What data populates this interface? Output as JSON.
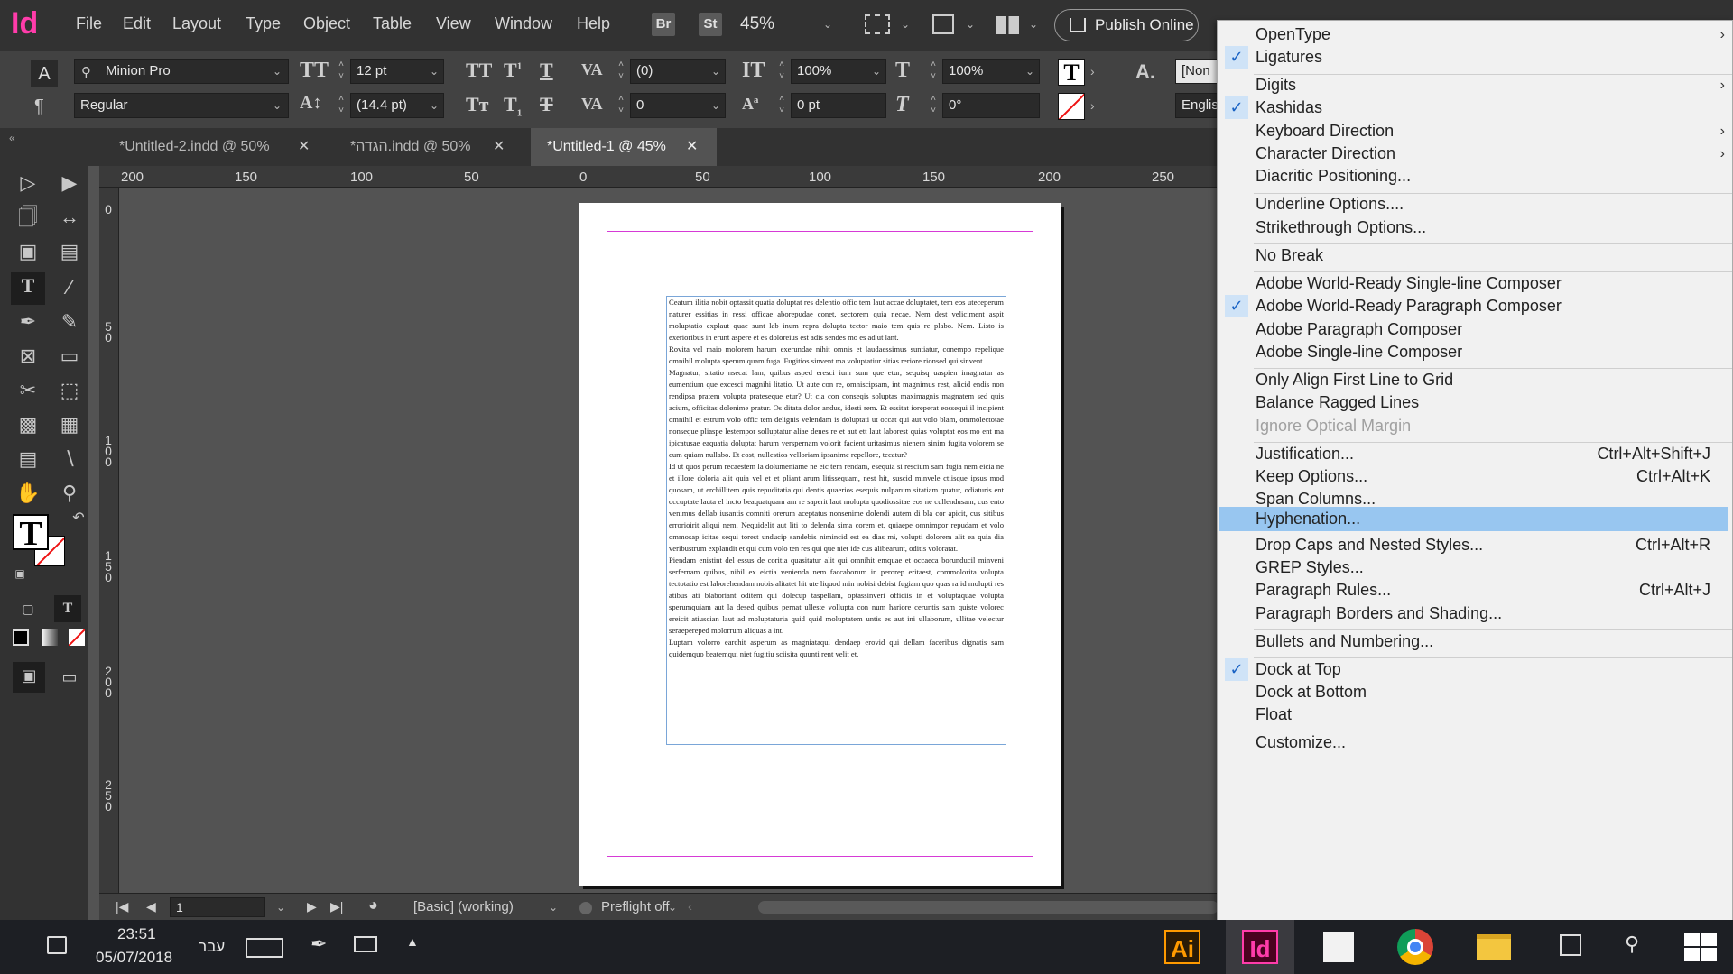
{
  "app": {
    "logo": "Id"
  },
  "menubar": {
    "items": [
      "File",
      "Edit",
      "Layout",
      "Type",
      "Object",
      "Table",
      "View",
      "Window",
      "Help"
    ],
    "bridge": "Br",
    "stock": "St",
    "zoom": "45%",
    "publish": "Publish Online"
  },
  "control": {
    "font_family": "Minion Pro",
    "font_style": "Regular",
    "font_size": "12 pt",
    "leading": "(14.4 pt)",
    "kerning": "(0)",
    "tracking": "0",
    "vscale": "100%",
    "hscale": "100%",
    "baseline": "0 pt",
    "skew": "0°",
    "style_box": "[Non",
    "language": "Englis"
  },
  "tabs": [
    {
      "label": "*Untitled-2.indd @ 50%"
    },
    {
      "label": "*הגדה.indd @ 50%"
    },
    {
      "label": "*Untitled-1 @ 45%"
    }
  ],
  "ruler": {
    "top": [
      "200",
      "150",
      "100",
      "50",
      "0",
      "50",
      "100",
      "150",
      "200",
      "250"
    ],
    "left": [
      "0",
      "50",
      "100",
      "150",
      "200",
      "250"
    ]
  },
  "document": {
    "paragraphs": [
      "Ceatum ilitia nobit optassit quatia doluptat res delentio offic tem laut accae doluptatet, tem eos uteceperum naturer essitias in ressi officae aborepudae conet, sectorem quia necae. Nem dest veliciment aspit moluptatio explaut quae sunt lab inum repra dolupta tector maio tem quis re plabo. Nem. Listo is exerioribus in erunt aspere et es doloreius est adis sendes mo es ad ut lant.",
      "Rovita vel maio molorem harum exerundae nihit omnis et laudaessimus suntiatur, conempo repelique omnihil molupta sperum quam fuga. Fugitios sinvent ma voluptatiur sitias reriore rionsed qui sinvent.",
      "Magnatur, sitatio nsecat lam, quibus asped eresci ium sum que etur, sequisq uaspien imagnatur as eumentium que excesci magnihi litatio. Ut aute con re, omniscipsam, int magnimus rest, alicid endis non rendipsa pratem volupta prateseque etur? Ut cia con conseqis soluptas maximagnis magnatem sed quis acium, officitas dolenime pratur. Os ditata dolor andus, idesti rem. Et essitat ioreperat eossequi il incipient omnihil et estrum volo offic tem delignis velendam is doluptati ut occat qui aut volo blam, ommolectotae nonseque pliaspe lestempor solluptatur aliae denes re et aut ett laut laborest quias voluptat eos mo ent ma ipicatusae eaquatia doluptat harum verspernam volorit facient uritasimus nienem sinim fugita volorem se cum quiam nullabo. Et eost, nullestios velloriam ipsanime repellore, tecatur?",
      "Id ut quos perum recaestem la dolumeniame ne eic tem rendam, esequia si rescium sam fugia nem eicia ne et illore doloria alit quia vel et et pliant arum litissequam, nest hit, suscid minvele ctiisque ipsus mod quosam, ut erchillitem quis repuditatia qui dentis quaerios esequis nulparum sitatiam quatur, odiaturis ent occuptate lauta el incto beaquatquam am re saperit laut molupta quodiossitae eos ne cullendusam, cus ento venimus dellab iusantis comniti orerum aceptatus nonsenime dolendi autem di bla cor apicit, cus sitibus errorioirit aliqui nem. Nequidelit aut liti to delenda sima corem et, quiaepe omnimpor repudam et volo ommosap icitae sequi torest unducip sandebis nimincid est ea dias mi, volupti dolorem alit ea quia dia veribustrum explandit et qui cum volo ten res qui que niet ide cus alibearunt, oditis voloratat.",
      "Piendam enistint del essus de coritia quasitatur alit qui omnihit emquae et occaeca borunducil minveni serfernam quibus, nihil ex eictia venienda nem faccaborum in perorep eritaest, commolorita volupta tectotatio est laborehendam nobis alitatet hit ute liquod min nobisi debist fugiam quo quas ra id molupti res atibus ati blaboriant oditem qui dolecup taspellam, optassinveri officiis in et voluptaquae volupta sperumquiam aut la desed quibus pernat ulleste vollupta con num hariore ceruntis sam quiste volorec ereicit atiuscian laut ad moluptaturia quid quid moluptatem untis es aut ini ullaborum, ullitae velectur seraepereped molorrum aliquas a int.",
      "Luptam volorro earchit asperum as magniataqui dendaep erovid qui dellam faceribus dignatis sam quidemquo beatemqui niet fugitiu sciisita quunti rent velit et."
    ]
  },
  "status": {
    "page": "1",
    "style": "[Basic] (working)",
    "preflight": "Preflight off"
  },
  "context_menu": {
    "items": [
      {
        "label": "OpenType",
        "submenu": true
      },
      {
        "label": "Ligatures",
        "checked": true
      },
      {
        "label": "Digits",
        "submenu": true
      },
      {
        "label": "Kashidas",
        "checked": true
      },
      {
        "label": "Keyboard Direction",
        "submenu": true
      },
      {
        "label": "Character Direction",
        "submenu": true
      },
      {
        "label": "Diacritic Positioning..."
      },
      {
        "label": "Underline Options...."
      },
      {
        "label": "Strikethrough Options..."
      },
      {
        "label": "No Break"
      },
      {
        "label": "Adobe World-Ready Single-line Composer"
      },
      {
        "label": "Adobe World-Ready Paragraph Composer",
        "checked": true
      },
      {
        "label": "Adobe Paragraph Composer"
      },
      {
        "label": "Adobe Single-line Composer"
      },
      {
        "label": "Only Align First Line to Grid"
      },
      {
        "label": "Balance Ragged Lines"
      },
      {
        "label": "Ignore Optical Margin",
        "disabled": true
      },
      {
        "label": "Justification...",
        "shortcut": "Ctrl+Alt+Shift+J"
      },
      {
        "label": "Keep Options...",
        "shortcut": "Ctrl+Alt+K"
      },
      {
        "label": "Span Columns..."
      },
      {
        "label": "Hyphenation...",
        "highlighted": true
      },
      {
        "label": "Drop Caps and Nested Styles...",
        "shortcut": "Ctrl+Alt+R"
      },
      {
        "label": "GREP Styles..."
      },
      {
        "label": "Paragraph Rules...",
        "shortcut": "Ctrl+Alt+J"
      },
      {
        "label": "Paragraph Borders and Shading..."
      },
      {
        "label": "Bullets and Numbering..."
      },
      {
        "label": "Dock at Top",
        "checked": true
      },
      {
        "label": "Dock at Bottom"
      },
      {
        "label": "Float"
      },
      {
        "label": "Customize..."
      }
    ]
  },
  "taskbar": {
    "time": "23:51",
    "date": "05/07/2018",
    "language": "עבר",
    "apps": [
      "Ai",
      "Id",
      "",
      "",
      ""
    ]
  },
  "colors": {
    "indesign_pink": "#ff3caa",
    "illustrator_orange": "#ff9a00",
    "menu_highlight": "#98c6f0",
    "margin_guide": "#d63ad6",
    "frame_blue": "#7aa6d8"
  },
  "icons": [
    "selection-icon",
    "direct-selection-icon",
    "type-icon",
    "line-icon",
    "pen-icon",
    "pencil-icon",
    "rectangle-frame-icon",
    "rectangle-icon",
    "scissors-icon",
    "free-transform-icon",
    "gradient-icon",
    "note-icon",
    "eyedropper-icon",
    "hand-icon",
    "zoom-icon",
    "check-icon",
    "submenu-arrow-icon"
  ]
}
